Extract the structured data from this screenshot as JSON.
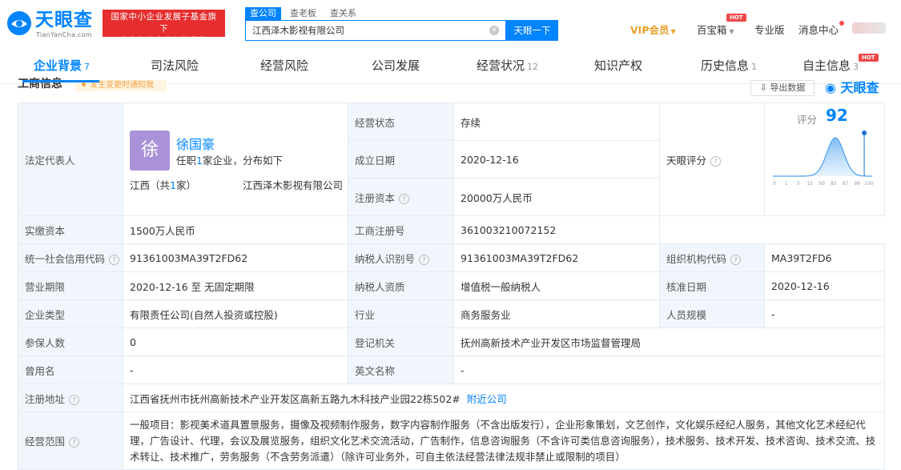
{
  "header": {
    "logo_text": "天眼查",
    "logo_sub": "TianYanCha.com",
    "badge_line1": "国家中小企业发展子基金旗下",
    "badge_line2": "官方备案企业征信机构",
    "search_tabs": [
      "查公司",
      "查老板",
      "查关系"
    ],
    "search_value": "江西泽木影视有限公司",
    "search_button": "天眼一下",
    "vip_label": "VIP会员",
    "baobao": "百宝箱",
    "hot": "HOT",
    "pro": "专业版",
    "messages": "消息中心"
  },
  "tabs": [
    {
      "label": "企业背景",
      "count": "7"
    },
    {
      "label": "司法风险",
      "count": ""
    },
    {
      "label": "经营风险",
      "count": ""
    },
    {
      "label": "公司发展",
      "count": ""
    },
    {
      "label": "经营状况",
      "count": "12"
    },
    {
      "label": "知识产权",
      "count": ""
    },
    {
      "label": "历史信息",
      "count": "1"
    },
    {
      "label": "自主信息",
      "count": "3"
    }
  ],
  "section": {
    "title": "工商信息",
    "change_tag": "发生变更时通知我",
    "export": "导出数据",
    "brand": "天眼查"
  },
  "colors": {
    "brand": "#0084ff",
    "badge_red": "#e62e2e",
    "vip": "#e8a02a",
    "label_bg": "#f1f6fc"
  },
  "info": {
    "legal_rep_label": "法定代表人",
    "legal_rep_avatar": "徐",
    "legal_rep_name": "徐国豪",
    "legal_rep_sub_a": "任职",
    "legal_rep_sub_n": "1",
    "legal_rep_sub_b": "家企业，分布如下",
    "legal_rep_prov_a": "江西（共",
    "legal_rep_prov_n": "1",
    "legal_rep_prov_b": "家）",
    "legal_rep_company": "江西泽木影视有限公司",
    "status_label": "经营状态",
    "status": "存续",
    "est_label": "成立日期",
    "est": "2020-12-16",
    "capital_label": "注册资本",
    "capital": "20000万人民币",
    "paid_label": "实缴资本",
    "paid": "1500万人民币",
    "score_label": "天眼评分",
    "score_word": "评分",
    "score": "92",
    "score_ticks": [
      "0",
      "1",
      "3",
      "15",
      "50",
      "85",
      "97",
      "99",
      "100"
    ],
    "reg_no_label": "工商注册号",
    "reg_no": "361003210072152",
    "credit_label": "统一社会信用代码",
    "credit": "91361003MA39T2FD62",
    "taxid_label": "纳税人识别号",
    "taxid": "91361003MA39T2FD62",
    "org_label": "组织机构代码",
    "org": "MA39T2FD6",
    "term_label": "营业期限",
    "term": "2020-12-16 至 无固定期限",
    "taxq_label": "纳税人资质",
    "taxq": "增值税一般纳税人",
    "approve_label": "核准日期",
    "approve": "2020-12-16",
    "type_label": "企业类型",
    "type": "有限责任公司(自然人投资或控股)",
    "industry_label": "行业",
    "industry": "商务服务业",
    "staff_label": "人员规模",
    "staff": "-",
    "insured_label": "参保人数",
    "insured": "0",
    "authority_label": "登记机关",
    "authority": "抚州高新技术产业开发区市场监督管理局",
    "former_label": "曾用名",
    "former": "-",
    "en_label": "英文名称",
    "en": "-",
    "addr_label": "注册地址",
    "addr": "江西省抚州市抚州高新技术产业开发区高新五路九木科技产业园22栋502#",
    "addr_link": "附近公司",
    "scope_label": "经营范围",
    "scope": "一般项目：影视美术道具置景服务，摄像及视频制作服务，数字内容制作服务（不含出版发行），企业形象策划，文艺创作，文化娱乐经纪人服务，其他文化艺术经纪代理，广告设计、代理，会议及展览服务，组织文化艺术交流活动，广告制作，信息咨询服务（不含许可类信息咨询服务），技术服务、技术开发、技术咨询、技术交流、技术转让、技术推广，劳务服务（不含劳务派遣）（除许可业务外，可自主依法经营法律法规非禁止或限制的项目）"
  }
}
